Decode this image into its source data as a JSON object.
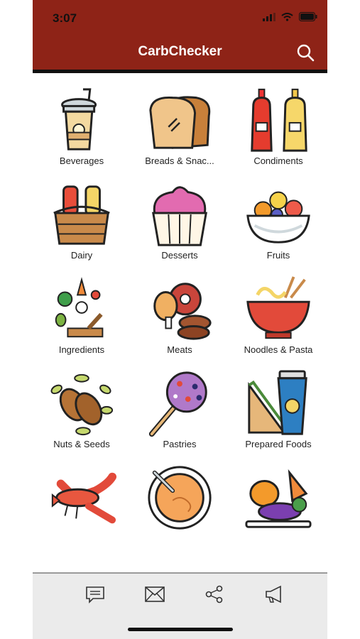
{
  "status": {
    "time": "3:07"
  },
  "header": {
    "title": "CarbChecker"
  },
  "categories": [
    {
      "label": "Beverages",
      "icon": "beverage-icon"
    },
    {
      "label": "Breads & Snac...",
      "icon": "bread-icon"
    },
    {
      "label": "Condiments",
      "icon": "condiments-icon"
    },
    {
      "label": "Dairy",
      "icon": "dairy-icon"
    },
    {
      "label": "Desserts",
      "icon": "cupcake-icon"
    },
    {
      "label": "Fruits",
      "icon": "fruit-bowl-icon"
    },
    {
      "label": "Ingredients",
      "icon": "ingredients-icon"
    },
    {
      "label": "Meats",
      "icon": "meat-icon"
    },
    {
      "label": "Noodles & Pasta",
      "icon": "noodle-bowl-icon"
    },
    {
      "label": "Nuts & Seeds",
      "icon": "nuts-icon"
    },
    {
      "label": "Pastries",
      "icon": "cake-pop-icon"
    },
    {
      "label": "Prepared Foods",
      "icon": "sandwich-coffee-icon"
    },
    {
      "label": "",
      "icon": "lobster-icon"
    },
    {
      "label": "",
      "icon": "soup-bowl-icon"
    },
    {
      "label": "",
      "icon": "vegetables-icon"
    }
  ],
  "tabbar": [
    "chat-icon",
    "mail-icon",
    "share-icon",
    "megaphone-icon"
  ],
  "colors": {
    "header": "#8e2317",
    "tabbar": "#ebebeb"
  }
}
